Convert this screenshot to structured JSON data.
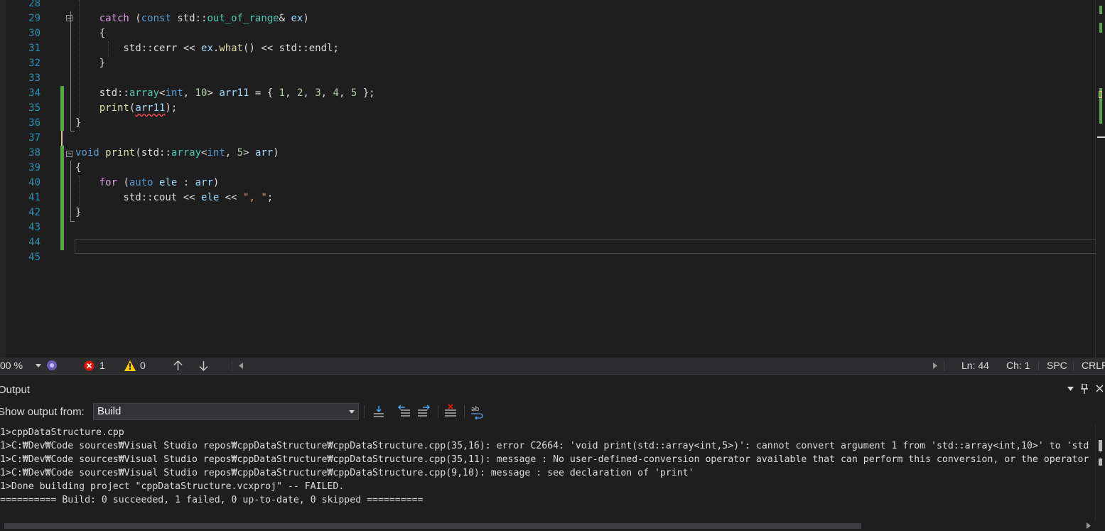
{
  "editor": {
    "lines": [
      {
        "n": "28",
        "html": ""
      },
      {
        "n": "29",
        "html": "    <span class='ctl'>catch</span> (<span class='kw'>const</span> std::<span class='ty'>out_of_range</span>&amp; <span class='var'>ex</span>)"
      },
      {
        "n": "30",
        "html": "    {"
      },
      {
        "n": "31",
        "html": "        std::cerr &lt;&lt; <span class='var'>ex</span>.<span class='fn'>what</span>() &lt;&lt; std::endl;"
      },
      {
        "n": "32",
        "html": "    }"
      },
      {
        "n": "33",
        "html": ""
      },
      {
        "n": "34",
        "html": "    std::<span class='ty'>array</span>&lt;<span class='kw'>int</span>, <span class='num'>10</span>&gt; <span class='var'>arr11</span> = { <span class='num'>1</span>, <span class='num'>2</span>, <span class='num'>3</span>, <span class='num'>4</span>, <span class='num'>5</span> };"
      },
      {
        "n": "35",
        "html": "    <span class='fn'>print</span>(<span class='var squig'>arr11</span>);"
      },
      {
        "n": "36",
        "html": "}"
      },
      {
        "n": "37",
        "html": ""
      },
      {
        "n": "38",
        "html": "<span class='kw'>void</span> <span class='fn'>print</span>(std::<span class='ty'>array</span>&lt;<span class='kw'>int</span>, <span class='num'>5</span>&gt; <span class='var'>arr</span>)"
      },
      {
        "n": "39",
        "html": "{"
      },
      {
        "n": "40",
        "html": "    <span class='ctl'>for</span> (<span class='kw'>auto</span> <span class='var'>ele</span> : <span class='var'>arr</span>)"
      },
      {
        "n": "41",
        "html": "        std::cout &lt;&lt; <span class='var'>ele</span> &lt;&lt; <span class='str'>\", \"</span>;"
      },
      {
        "n": "42",
        "html": "}"
      },
      {
        "n": "43",
        "html": ""
      },
      {
        "n": "44",
        "html": ""
      },
      {
        "n": "45",
        "html": ""
      }
    ]
  },
  "status": {
    "zoom": "00 %",
    "errors": "1",
    "warnings": "0",
    "line": "Ln: 44",
    "char": "Ch: 1",
    "whitespace": "SPC",
    "eol": "CRLF"
  },
  "output": {
    "title": "Output",
    "show_label": "Show output from:",
    "source": "Build",
    "lines": [
      "1>cppDataStructure.cpp",
      "1>C:₩Dev₩Code sources₩Visual Studio repos₩cppDataStructure₩cppDataStructure.cpp(35,16): error C2664: 'void print(std::array<int,5>)': cannot convert argument 1 from 'std::array<int,10>' to 'std",
      "1>C:₩Dev₩Code sources₩Visual Studio repos₩cppDataStructure₩cppDataStructure.cpp(35,11): message : No user-defined-conversion operator available that can perform this conversion, or the operator",
      "1>C:₩Dev₩Code sources₩Visual Studio repos₩cppDataStructure₩cppDataStructure.cpp(9,10): message : see declaration of 'print'",
      "1>Done building project \"cppDataStructure.vcxproj\" -- FAILED.",
      "========== Build: 0 succeeded, 1 failed, 0 up-to-date, 0 skipped =========="
    ]
  },
  "icons": {
    "dropdown": "chevron-down-icon",
    "pin": "pin-icon",
    "close": "close-icon"
  }
}
